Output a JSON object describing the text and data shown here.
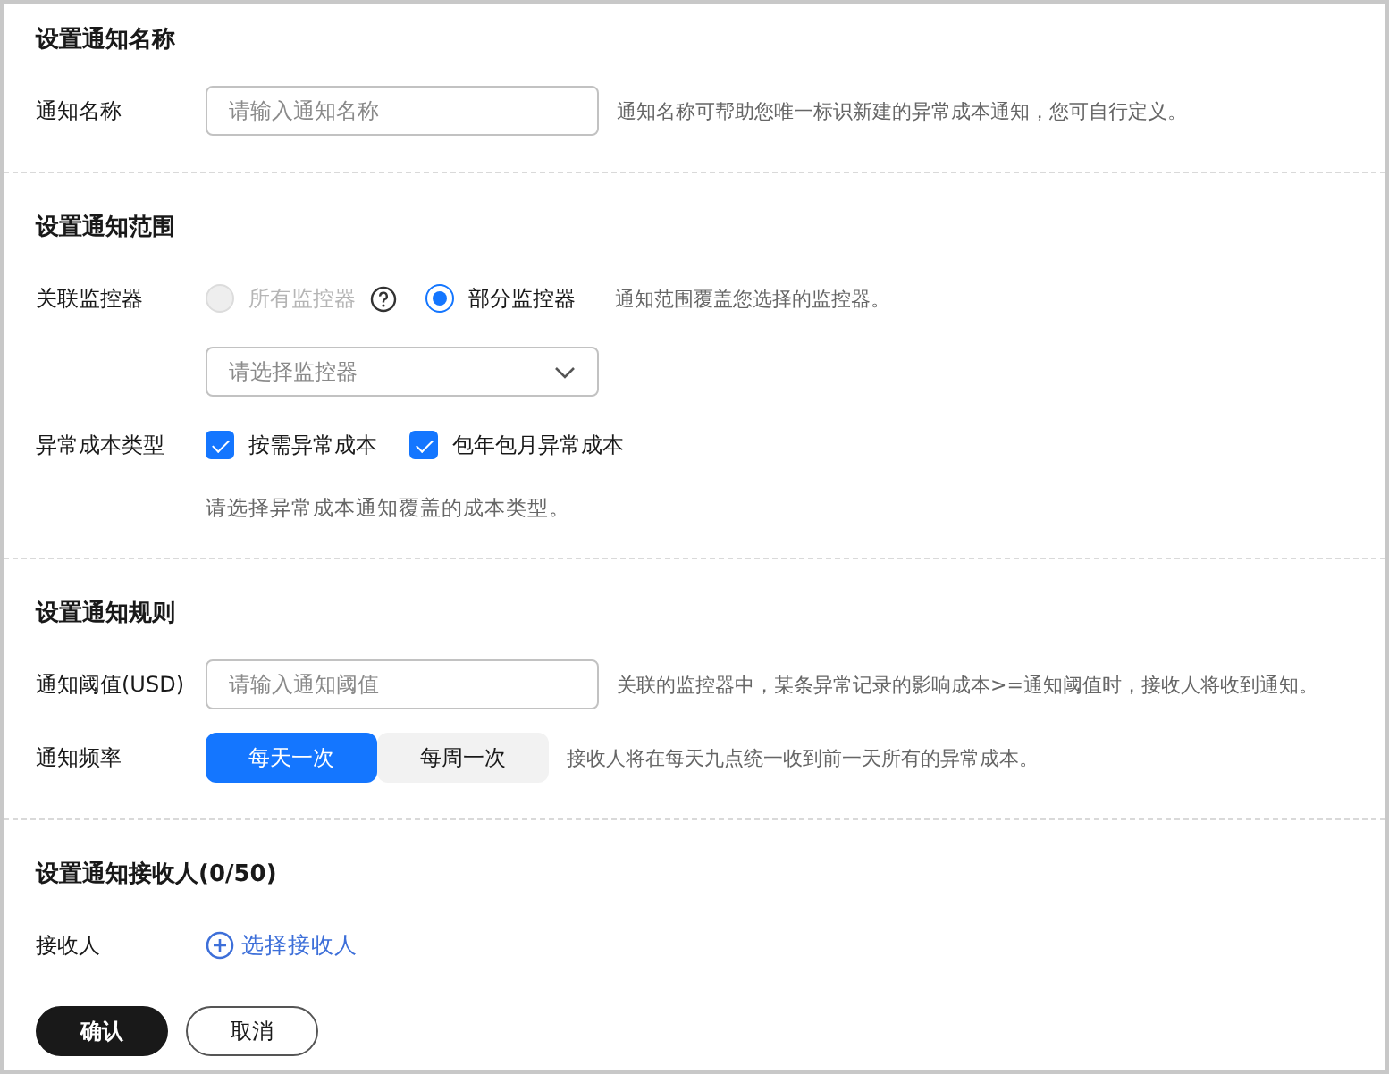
{
  "sections": [
    {
      "title": "设置通知名称",
      "rows": [
        {
          "kind": "text_input",
          "label": "通知名称",
          "placeholder": "请输入通知名称",
          "hint": "通知名称可帮助您唯一标识新建的异常成本通知，您可自行定义。"
        }
      ]
    },
    {
      "title": "设置通知范围",
      "rows": [
        {
          "kind": "radio",
          "label": "关联监控器",
          "options": [
            {
              "label": "所有监控器",
              "selected": false,
              "disabled": true,
              "help": true
            },
            {
              "label": "部分监控器",
              "selected": true,
              "disabled": false,
              "help": false
            }
          ],
          "hint": "通知范围覆盖您选择的监控器。"
        },
        {
          "kind": "select",
          "placeholder": "请选择监控器"
        },
        {
          "kind": "checkbox",
          "label": "异常成本类型",
          "options": [
            {
              "label": "按需异常成本",
              "checked": true
            },
            {
              "label": "包年包月异常成本",
              "checked": true
            }
          ]
        },
        {
          "kind": "note",
          "text": "请选择异常成本通知覆盖的成本类型。"
        }
      ]
    },
    {
      "title": "设置通知规则",
      "rows": [
        {
          "kind": "text_input",
          "label": "通知阈值(USD)",
          "placeholder": "请输入通知阈值",
          "hint": "关联的监控器中，某条异常记录的影响成本>=通知阈值时，接收人将收到通知。"
        },
        {
          "kind": "segmented",
          "label": "通知频率",
          "options": [
            {
              "label": "每天一次",
              "selected": true
            },
            {
              "label": "每周一次",
              "selected": false
            }
          ],
          "hint": "接收人将在每天九点统一收到前一天所有的异常成本。"
        }
      ]
    },
    {
      "title": "设置通知接收人(0/50)",
      "rows": [
        {
          "kind": "add_link",
          "label": "接收人",
          "link": "选择接收人"
        }
      ]
    }
  ],
  "buttons": [
    {
      "label": "确认",
      "kind": "primary"
    },
    {
      "label": "取消",
      "kind": "secondary"
    }
  ]
}
